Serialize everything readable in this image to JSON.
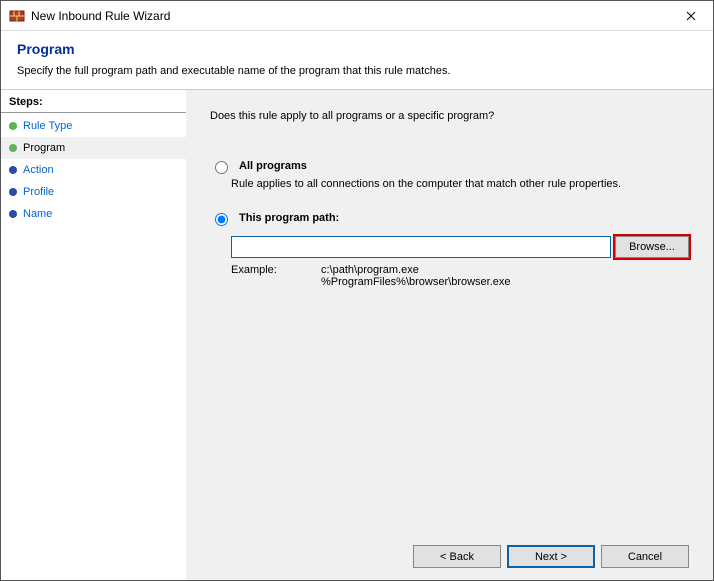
{
  "window": {
    "title": "New Inbound Rule Wizard"
  },
  "header": {
    "title": "Program",
    "subtitle": "Specify the full program path and executable name of the program that this rule matches."
  },
  "sidebar": {
    "header": "Steps:",
    "items": [
      {
        "label": "Rule Type",
        "state": "done"
      },
      {
        "label": "Program",
        "state": "active"
      },
      {
        "label": "Action",
        "state": "todo"
      },
      {
        "label": "Profile",
        "state": "todo"
      },
      {
        "label": "Name",
        "state": "todo"
      }
    ]
  },
  "main": {
    "question": "Does this rule apply to all programs or a specific program?",
    "options": {
      "all": {
        "label": "All programs",
        "desc": "Rule applies to all connections on the computer that match other rule properties.",
        "selected": false
      },
      "path": {
        "label": "This program path:",
        "selected": true,
        "value": "",
        "browse_label": "Browse...",
        "example_label": "Example:",
        "example1": "c:\\path\\program.exe",
        "example2": "%ProgramFiles%\\browser\\browser.exe"
      }
    }
  },
  "footer": {
    "back": "< Back",
    "next": "Next >",
    "cancel": "Cancel"
  }
}
